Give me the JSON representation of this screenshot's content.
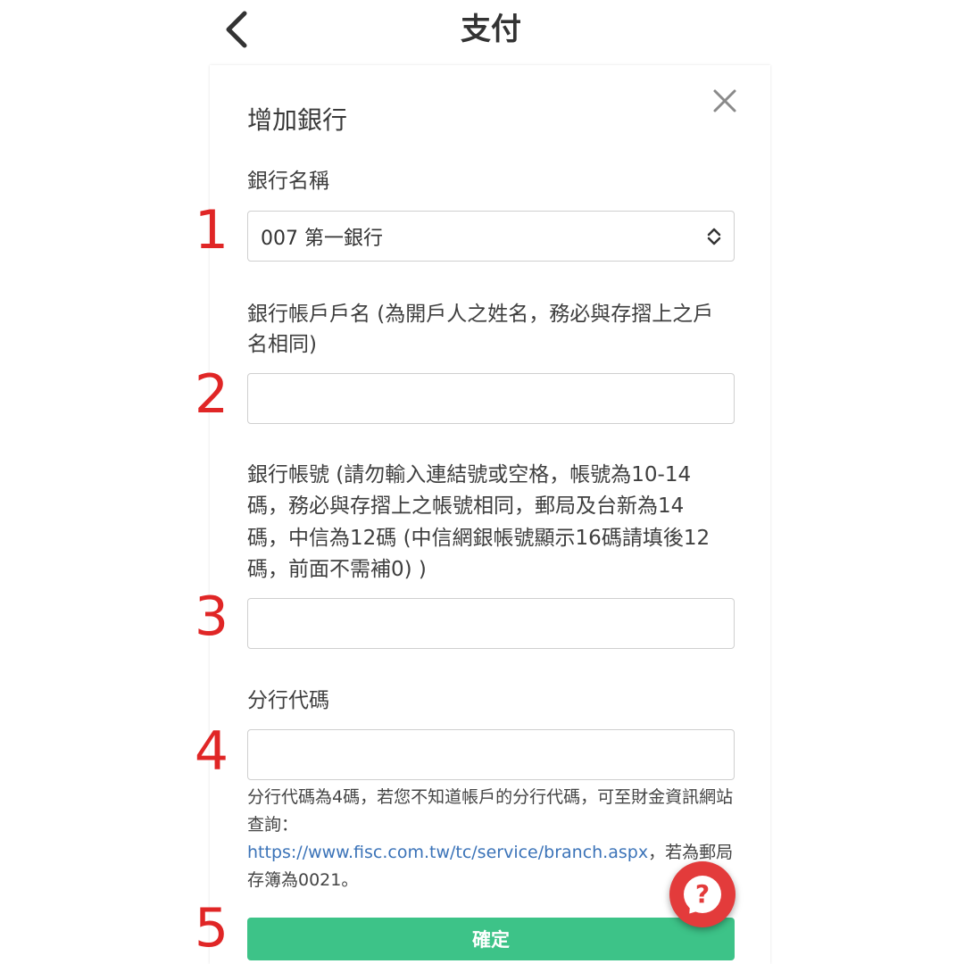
{
  "header": {
    "title": "支付"
  },
  "modal": {
    "title": "增加銀行",
    "fields": {
      "bank_name": {
        "step": "1",
        "label": "銀行名稱",
        "selected_value": "007 第一銀行"
      },
      "account_holder": {
        "step": "2",
        "label_line1": "銀行帳戶戶名 (為開戶人之姓名，務必與存摺上之戶",
        "label_line2": "名相同)",
        "value": "",
        "placeholder": ""
      },
      "account_number": {
        "step": "3",
        "label_line1": "銀行帳號 (請勿輸入連結號或空格，帳號為10-14",
        "label_line2": "碼，務必與存摺上之帳號相同，郵局及台新為14",
        "label_line3": "碼，中信為12碼 (中信網銀帳號顯示16碼請填後12",
        "label_line4": "碼，前面不需補0) )",
        "value": "",
        "placeholder": ""
      },
      "branch_code": {
        "step": "4",
        "label": "分行代碼",
        "value": "",
        "placeholder": "",
        "help_text_part1": "分行代碼為4碼，若您不知道帳戶的分行代碼，可至財金資訊網站查詢：",
        "help_link": "https://www.fisc.com.tw/tc/service/branch.aspx",
        "help_text_part2": "，若為郵局存簿為0021。"
      }
    },
    "confirm": {
      "step": "5",
      "label": "確定"
    }
  },
  "icons": {
    "back": "chevron-left-icon",
    "close": "close-icon",
    "select_arrows": "select-updown-icon",
    "help": "question-bubble-icon"
  },
  "colors": {
    "accent_green": "#3dc388",
    "step_red": "#e02626",
    "link_blue": "#3b73b8",
    "help_red": "#e33b3b"
  }
}
